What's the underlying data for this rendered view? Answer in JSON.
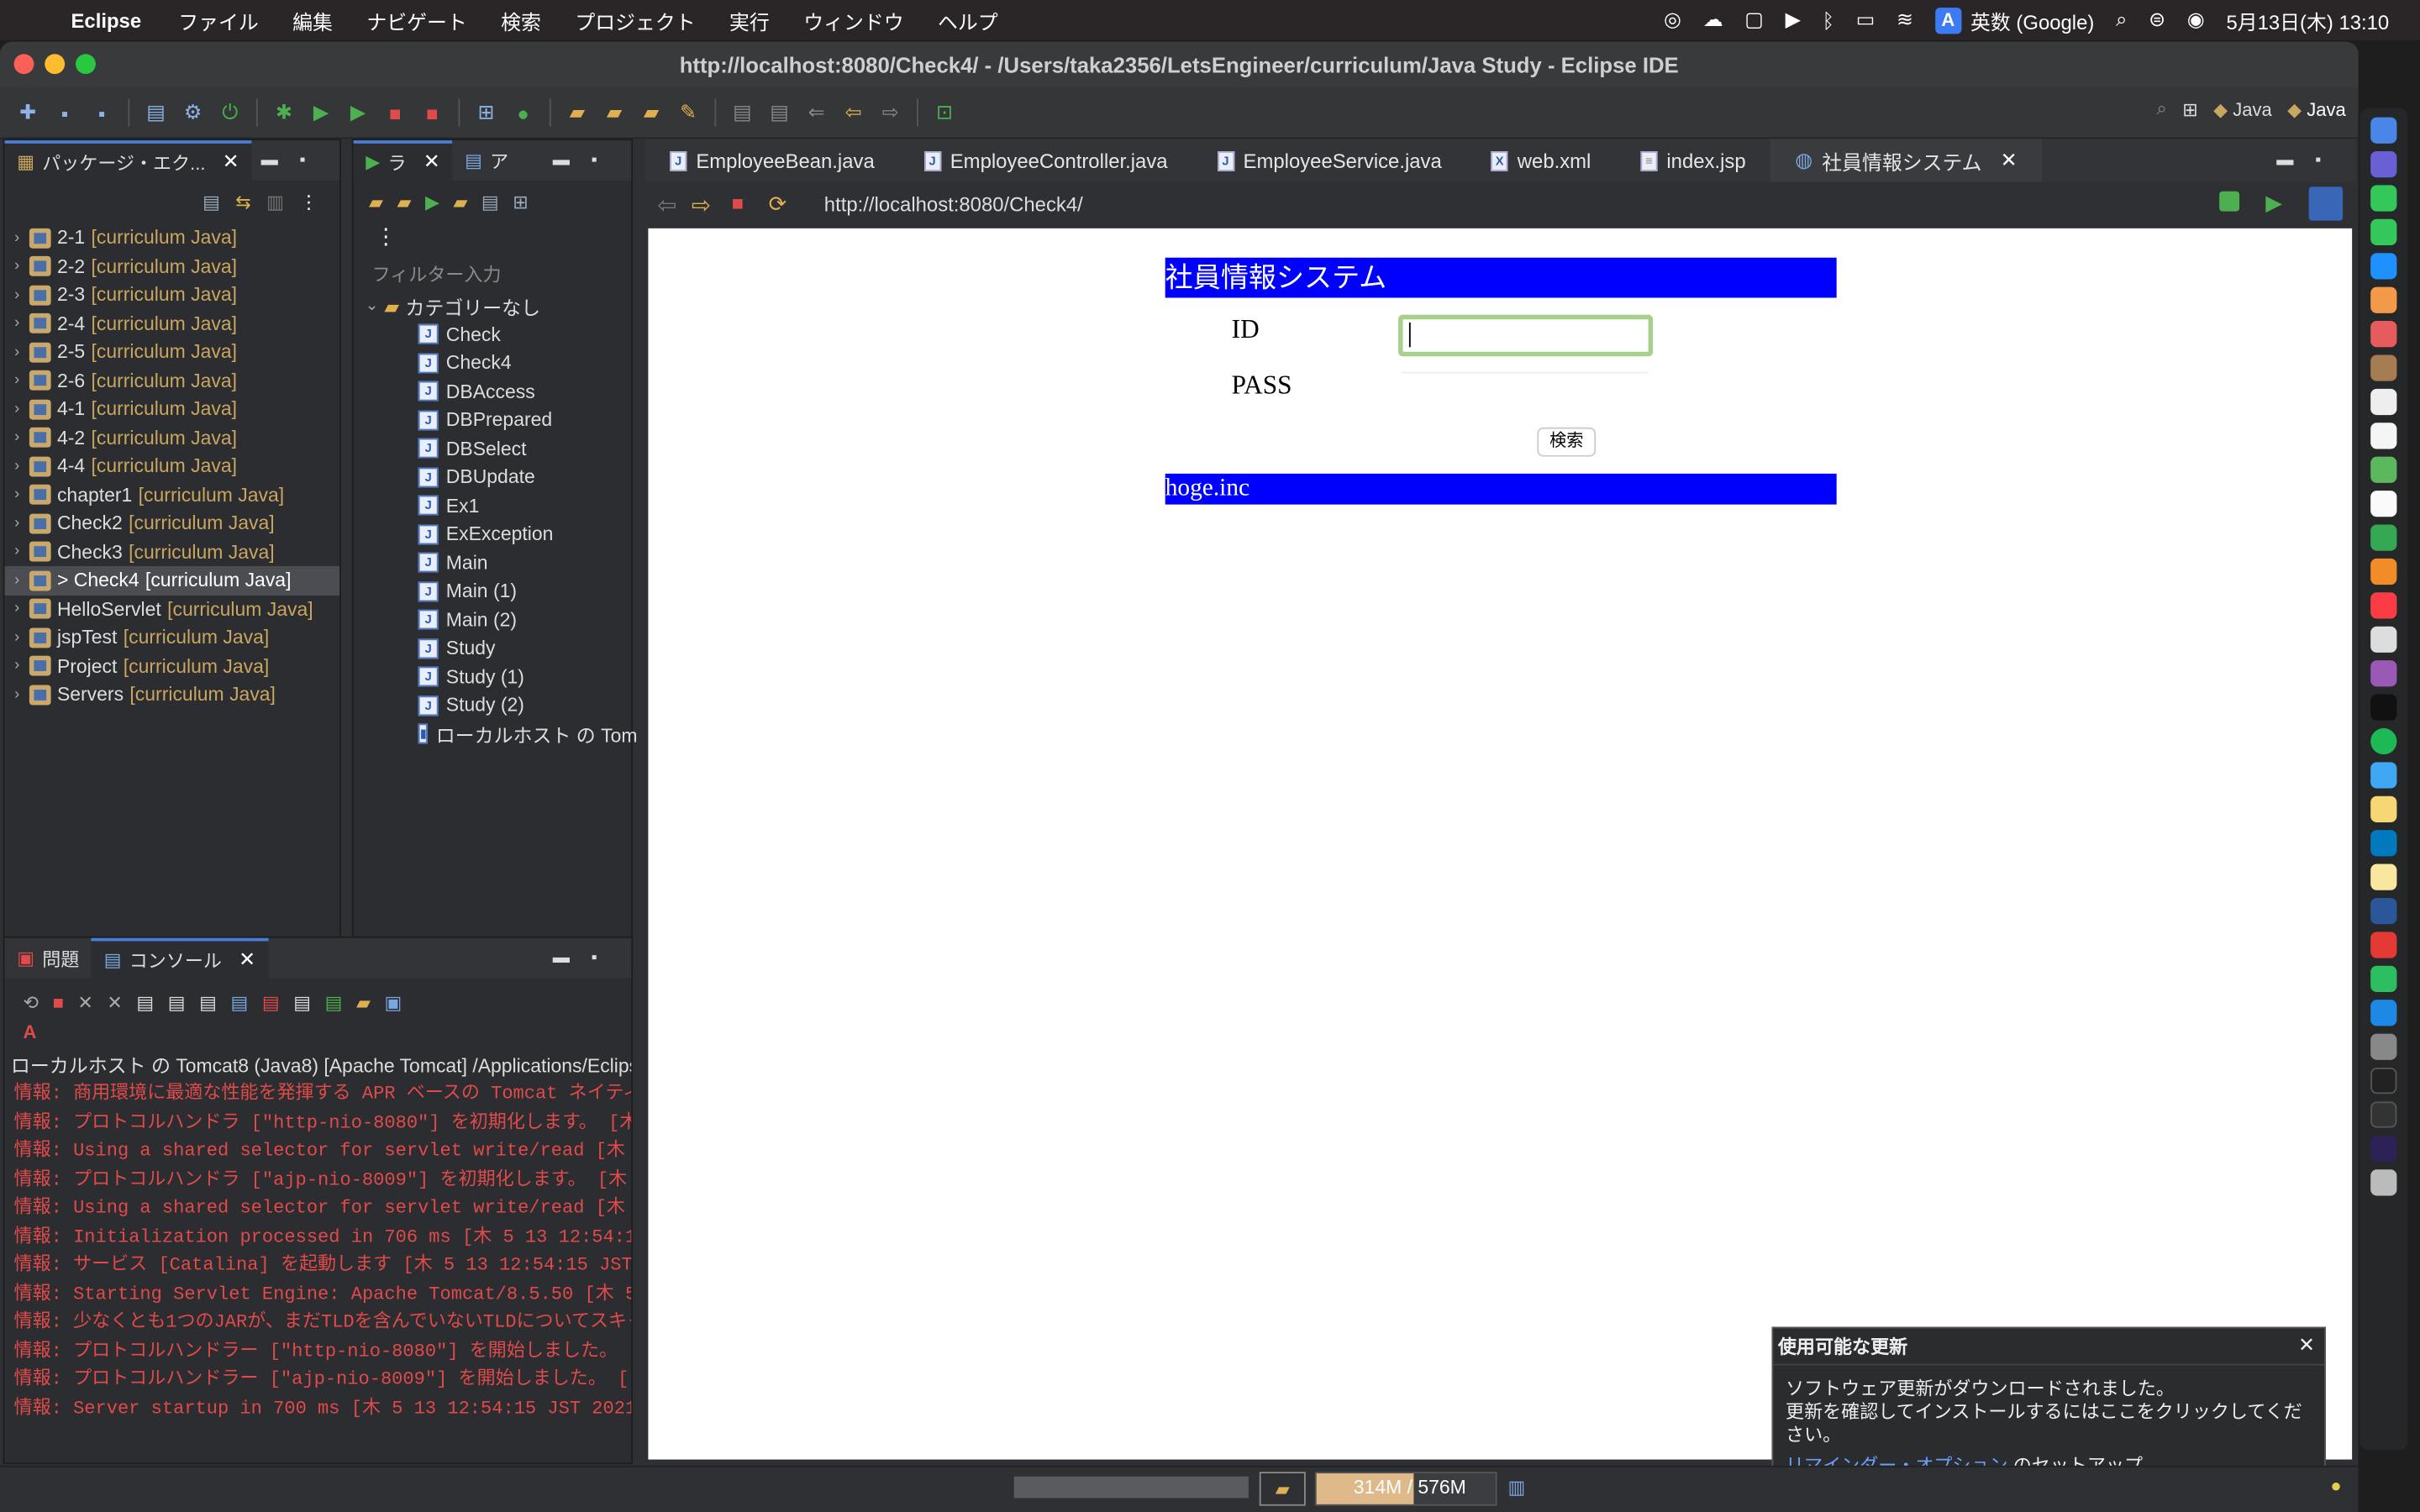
{
  "menubar": {
    "app": "Eclipse",
    "items": [
      "ファイル",
      "編集",
      "ナビゲート",
      "検索",
      "プロジェクト",
      "実行",
      "ウィンドウ",
      "ヘルプ"
    ],
    "ime": "英数 (Google)",
    "ime_letter": "A",
    "datetime": "5月13日(木)  13:10"
  },
  "window": {
    "title": "http://localhost:8080/Check4/ - /Users/taka2356/LetsEngineer/curriculum/Java Study - Eclipse IDE"
  },
  "perspectives": [
    "Java",
    "Java"
  ],
  "package_explorer": {
    "tab": "パッケージ・エク...",
    "projects": [
      {
        "name": "2-1",
        "tag": "[curriculum Java]"
      },
      {
        "name": "2-2",
        "tag": "[curriculum Java]"
      },
      {
        "name": "2-3",
        "tag": "[curriculum Java]"
      },
      {
        "name": "2-4",
        "tag": "[curriculum Java]"
      },
      {
        "name": "2-5",
        "tag": "[curriculum Java]"
      },
      {
        "name": "2-6",
        "tag": "[curriculum Java]"
      },
      {
        "name": "4-1",
        "tag": "[curriculum Java]"
      },
      {
        "name": "4-2",
        "tag": "[curriculum Java]"
      },
      {
        "name": "4-4",
        "tag": "[curriculum Java]"
      },
      {
        "name": "chapter1",
        "tag": "[curriculum Java]"
      },
      {
        "name": "Check2",
        "tag": "[curriculum Java]"
      },
      {
        "name": "Check3",
        "tag": "[curriculum Java]"
      },
      {
        "name": "> Check4",
        "tag": "[curriculum Java]"
      },
      {
        "name": "HelloServlet",
        "tag": "[curriculum Java]"
      },
      {
        "name": "jspTest",
        "tag": "[curriculum Java]"
      },
      {
        "name": "Project",
        "tag": "[curriculum Java]"
      },
      {
        "name": "Servers",
        "tag": "[curriculum Java]"
      }
    ]
  },
  "launch": {
    "tab1": "ラ",
    "tab2": "ア",
    "filter_placeholder": "フィルター入力",
    "category": "カテゴリーなし",
    "items": [
      "Check",
      "Check4",
      "DBAccess",
      "DBPrepared",
      "DBSelect",
      "DBUpdate",
      "Ex1",
      "ExException",
      "Main",
      "Main (1)",
      "Main (2)",
      "Study",
      "Study (1)",
      "Study (2)",
      "ローカルホスト の Tom"
    ]
  },
  "editor": {
    "tabs": [
      "EmployeeBean.java",
      "EmployeeController.java",
      "EmployeeService.java",
      "web.xml",
      "index.jsp",
      "社員情報システム"
    ],
    "url": "http://localhost:8080/Check4/"
  },
  "webpage": {
    "header": "社員情報システム",
    "id_label": "ID",
    "pass_label": "PASS",
    "search_button": "検索",
    "footer": "hoge.inc"
  },
  "console": {
    "tab_problems": "問題",
    "tab_console": "コンソール",
    "description": "ローカルホスト の Tomcat8 (Java8) [Apache Tomcat] /Applications/Eclips",
    "lines": [
      "情報: 商用環境に最適な性能を発揮する APR ベースの Tomcat ネイティ",
      "情報: プロトコルハンドラ [\"http-nio-8080\"] を初期化します。 [木",
      "情報: Using a shared selector for servlet write/read [木",
      "情報: プロトコルハンドラ [\"ajp-nio-8009\"] を初期化します。 [木",
      "情報: Using a shared selector for servlet write/read [木",
      "情報: Initialization processed in 706 ms [木 5 13 12:54:1",
      "情報: サービス [Catalina] を起動します [木 5 13 12:54:15 JST",
      "情報: Starting Servlet Engine: Apache Tomcat/8.5.50 [木 5",
      "情報: 少なくとも1つのJARが、まだTLDを含んでいないTLDについてスキャ",
      "情報: プロトコルハンドラー [\"http-nio-8080\"] を開始しました。 [",
      "情報: プロトコルハンドラー [\"ajp-nio-8009\"] を開始しました。 [",
      "情報: Server startup in 700 ms [木 5 13 12:54:15 JST 2021"
    ]
  },
  "notification": {
    "title": "使用可能な更新",
    "line1": "ソフトウェア更新がダウンロードされました。",
    "line2": "更新を確認してインストールするにはここをクリックしてください。",
    "link": "リマインダー・オプション",
    "link_suffix": " のセットアップ"
  },
  "status": {
    "heap": "314M / 576M",
    "heap_used_fraction": 0.545
  },
  "colors": {
    "web_header": "#0000ff",
    "console_text": "#e04a4a",
    "project_tag": "#c9a660"
  }
}
